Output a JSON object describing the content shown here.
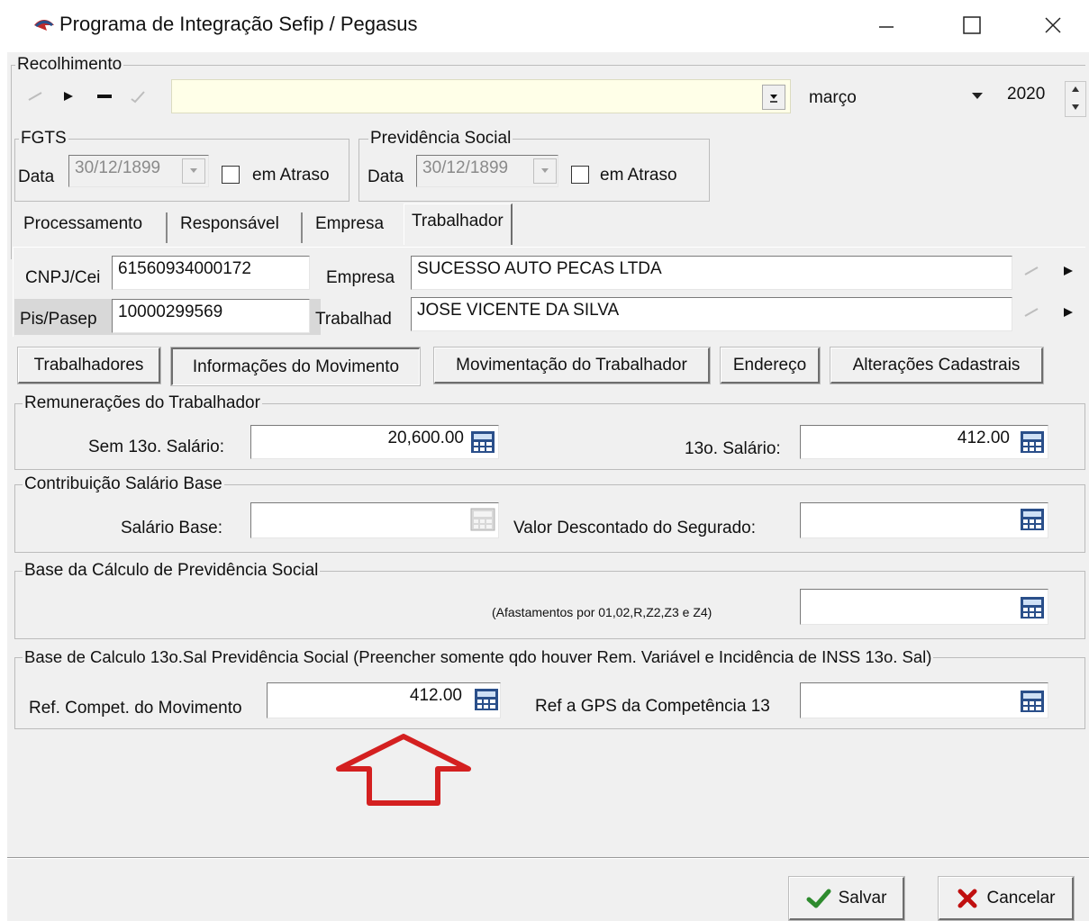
{
  "window": {
    "title": "Programa de Integração Sefip / Pegasus",
    "minimize_icon": "minimize-icon",
    "maximize_icon": "maximize-icon",
    "close_icon": "close-icon"
  },
  "recolhimento": {
    "title": "Recolhimento",
    "combo_value": "",
    "month": "março",
    "year": "2020"
  },
  "fgts": {
    "title": "FGTS",
    "date_label": "Data",
    "date_value": "30/12/1899",
    "late_label": "em Atraso",
    "late_checked": false
  },
  "previdencia": {
    "title": "Previdência Social",
    "date_label": "Data",
    "date_value": "30/12/1899",
    "late_label": "em Atraso",
    "late_checked": false
  },
  "main_tabs": [
    {
      "label": "Processamento",
      "active": false
    },
    {
      "label": "Responsável",
      "active": false
    },
    {
      "label": "Empresa",
      "active": false
    },
    {
      "label": "Trabalhador",
      "active": true
    }
  ],
  "header": {
    "cnpj_label": "CNPJ/Cei",
    "cnpj_value": "61560934000172",
    "empresa_label": "Empresa",
    "empresa_value": "SUCESSO AUTO PECAS LTDA",
    "pis_label": "Pis/Pasep",
    "pis_value": "10000299569",
    "trabalhador_label": "Trabalhad",
    "trabalhador_value": "JOSE VICENTE DA SILVA"
  },
  "sub_tabs": [
    {
      "label": "Trabalhadores",
      "active": false
    },
    {
      "label": "Informações do Movimento",
      "active": true
    },
    {
      "label": "Movimentação do Trabalhador",
      "active": false
    },
    {
      "label": "Endereço",
      "active": false
    },
    {
      "label": "Alterações Cadastrais",
      "active": false
    }
  ],
  "remuneracoes": {
    "title": "Remunerações do Trabalhador",
    "sem13_label": "Sem 13o. Salário:",
    "sem13_value": "20,600.00",
    "s13_label": "13o. Salário:",
    "s13_value": "412.00"
  },
  "contribuicao": {
    "title": "Contribuição Salário Base",
    "salario_base_label": "Salário Base:",
    "salario_base_value": "",
    "valor_descontado_label": "Valor Descontado do Segurado:",
    "valor_descontado_value": ""
  },
  "base_calculo": {
    "title": "Base da Cálculo de Previdência Social",
    "afastamentos_label": "(Afastamentos por 01,02,R,Z2,Z3 e Z4)",
    "afastamentos_value": ""
  },
  "base_13": {
    "title": "Base de Calculo 13o.Sal Previdência Social (Preencher somente qdo houver Rem. Variável e Incidência de INSS 13o. Sal)",
    "ref_compet_label": "Ref. Compet. do Movimento",
    "ref_compet_value": "412.00",
    "ref_gps_label": "Ref a GPS da Competência 13",
    "ref_gps_value": ""
  },
  "footer": {
    "salvar_label": "Salvar",
    "cancelar_label": "Cancelar"
  },
  "colors": {
    "annotation_arrow": "#d42020",
    "combo_bg": "#ffffe8",
    "calc_icon": "#2a4f8a",
    "check_green": "#2e8b2e",
    "cancel_red": "#c01010"
  }
}
